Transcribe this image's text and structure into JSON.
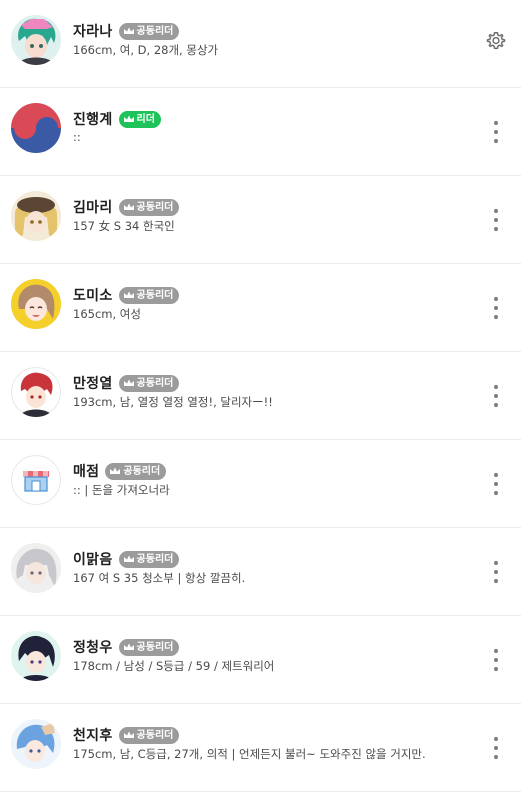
{
  "colors": {
    "badge_gray": "#9b9b9b",
    "badge_green": "#1ec35a",
    "divider": "#ececec"
  },
  "members": [
    {
      "name": "자라나",
      "badge": "공동리더",
      "badge_type": "co-leader",
      "desc": "166cm, 여, D, 28개, 몽상가",
      "action_icon": "gear-icon"
    },
    {
      "name": "진행계",
      "badge": "리더",
      "badge_type": "leader",
      "desc": "::",
      "action_icon": "more-vertical-icon"
    },
    {
      "name": "김마리",
      "badge": "공동리더",
      "badge_type": "co-leader",
      "desc": "157 女 S 34 한국인",
      "action_icon": "more-vertical-icon"
    },
    {
      "name": "도미소",
      "badge": "공동리더",
      "badge_type": "co-leader",
      "desc": "165cm, 여성",
      "action_icon": "more-vertical-icon"
    },
    {
      "name": "만정열",
      "badge": "공동리더",
      "badge_type": "co-leader",
      "desc": "193cm, 남, 열정 열정 열정!, 달리자ー!!",
      "action_icon": "more-vertical-icon"
    },
    {
      "name": "매점",
      "badge": "공동리더",
      "badge_type": "co-leader",
      "desc": ":: | 돈을 가져오너라",
      "action_icon": "more-vertical-icon"
    },
    {
      "name": "이맑음",
      "badge": "공동리더",
      "badge_type": "co-leader",
      "desc": "167 여 S 35 청소부 | 항상 깔끔히.",
      "action_icon": "more-vertical-icon"
    },
    {
      "name": "정청우",
      "badge": "공동리더",
      "badge_type": "co-leader",
      "desc": "178cm / 남성 / S등급 / 59 / 제트워리어",
      "action_icon": "more-vertical-icon"
    },
    {
      "name": "천지후",
      "badge": "공동리더",
      "badge_type": "co-leader",
      "desc": "175cm, 남, C등급, 27개, 의적 | 언제든지 불러~ 도와주진 않을 거지만.",
      "action_icon": "more-vertical-icon"
    }
  ]
}
